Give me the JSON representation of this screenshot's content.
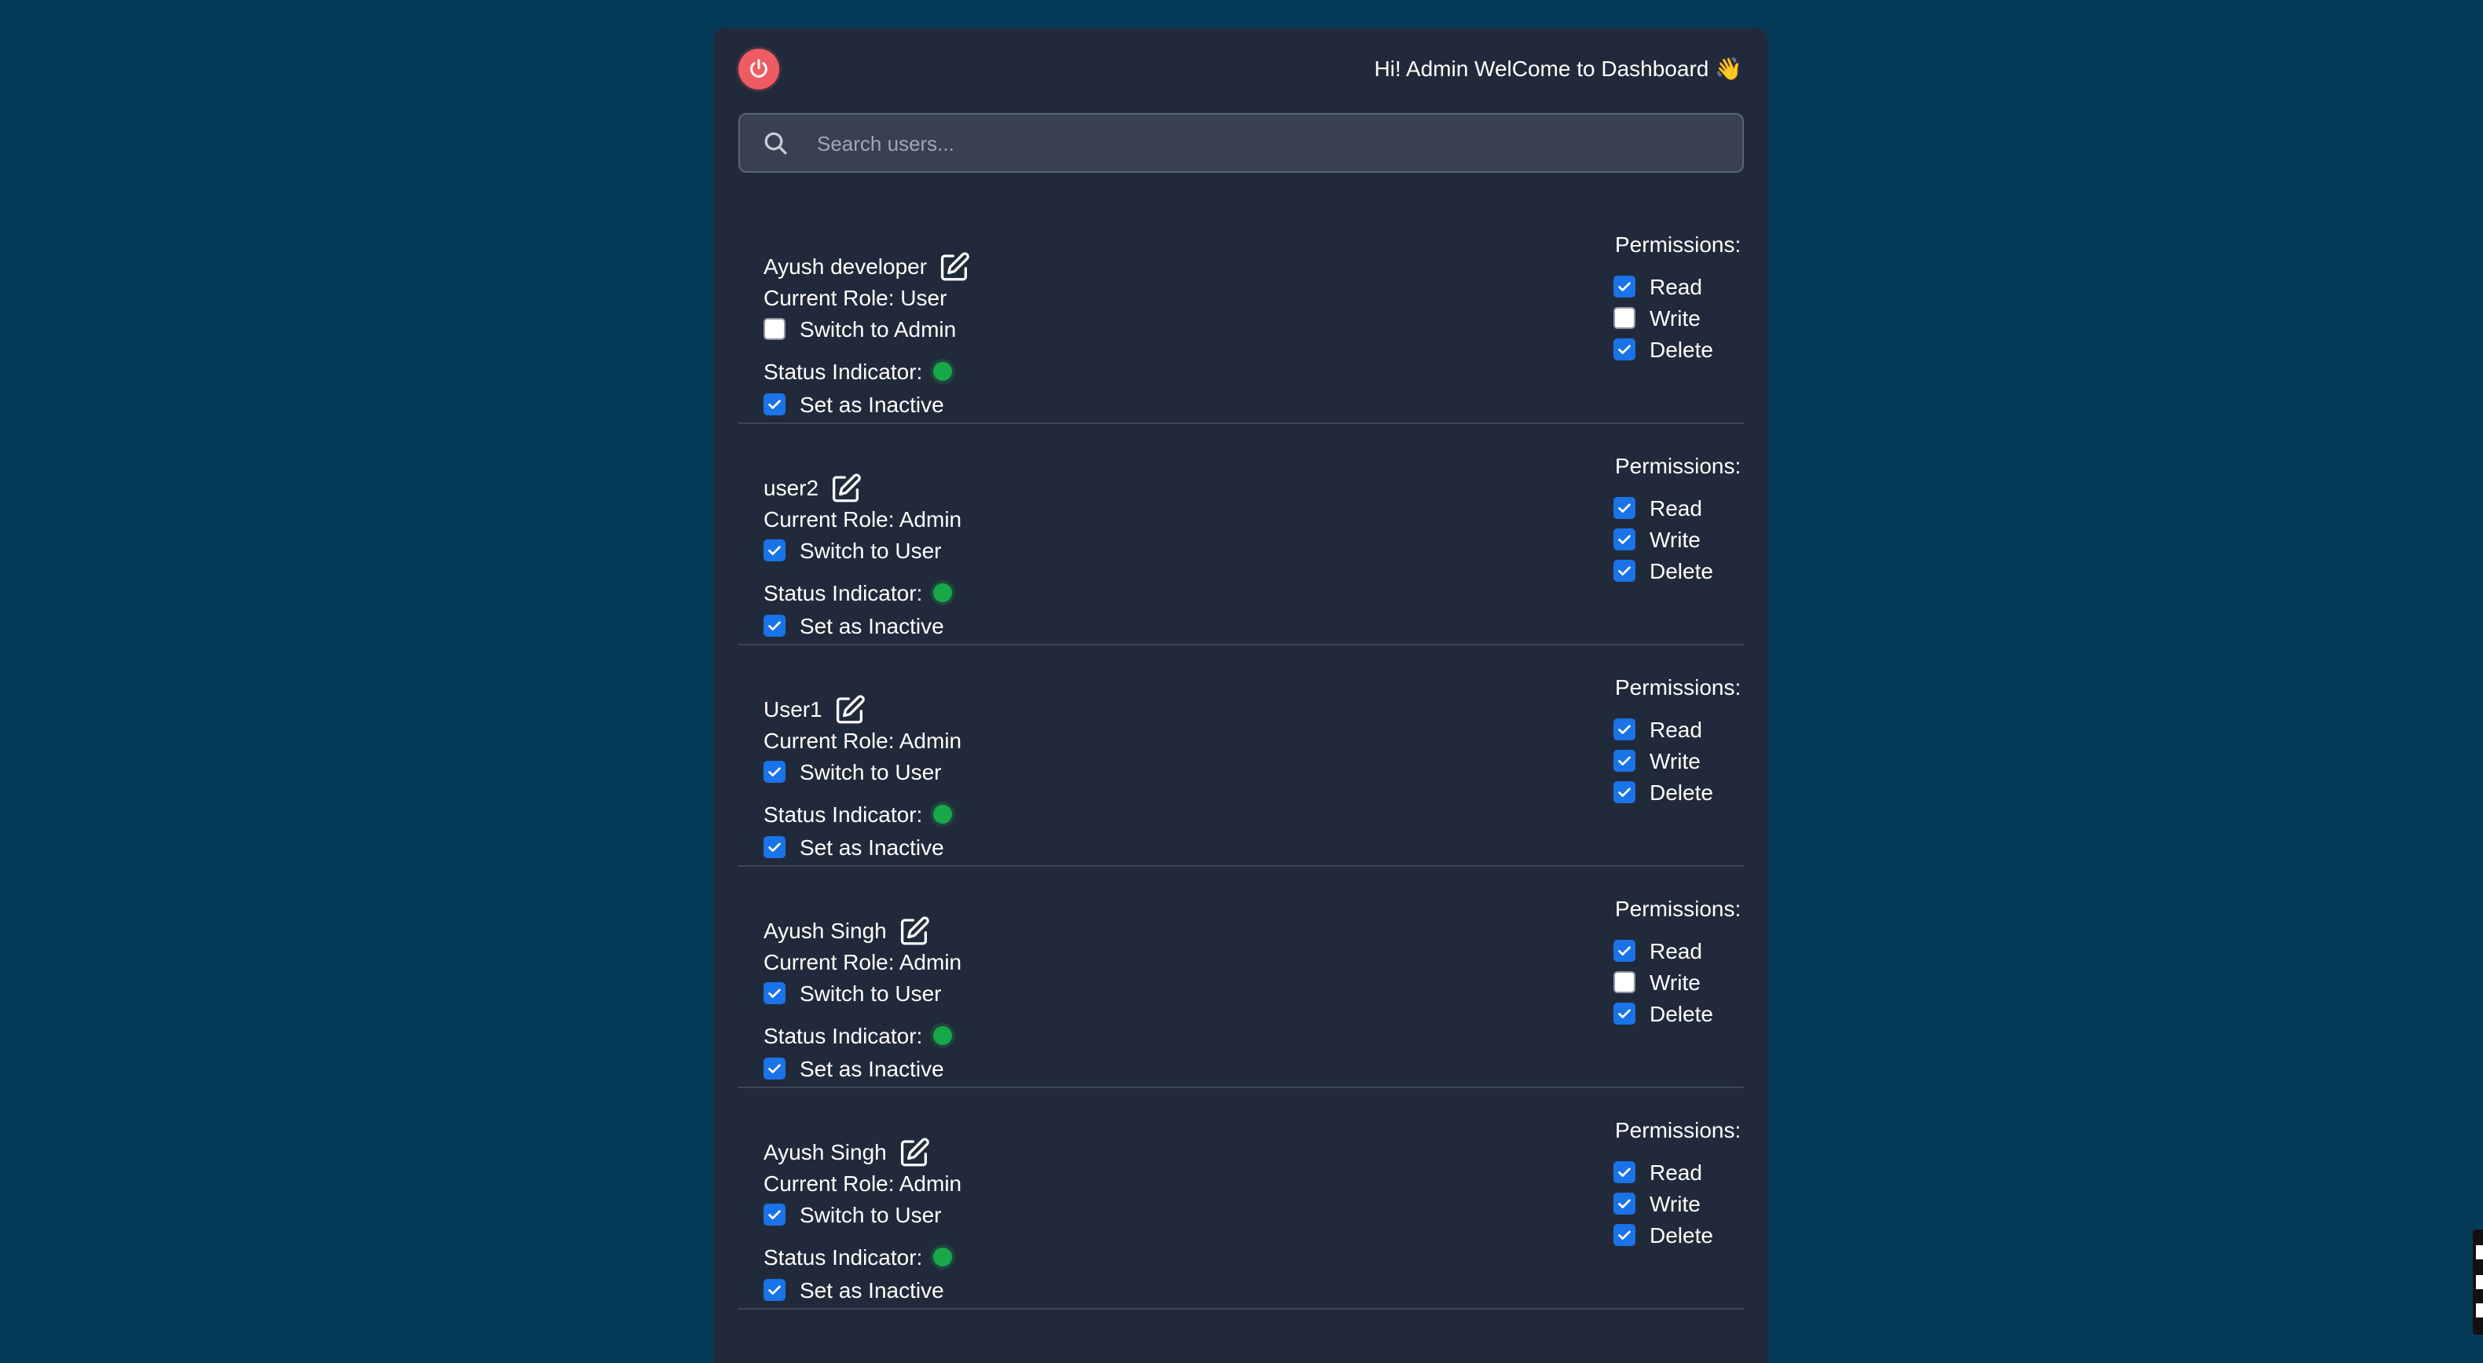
{
  "header": {
    "greeting": "Hi! Admin WelCome to Dashboard 👋"
  },
  "search": {
    "placeholder": "Search users...",
    "value": ""
  },
  "labels": {
    "permissions": "Permissions:",
    "status_indicator": "Status Indicator:",
    "read": "Read",
    "write": "Write",
    "delete": "Delete"
  },
  "users": [
    {
      "name": "Ayush developer",
      "role_text": "Current Role: User",
      "switch_label": "Switch to Admin",
      "switch_checked": false,
      "inactive_label": "Set as Inactive",
      "inactive_checked": true,
      "status_color": "#18a84a",
      "permissions": {
        "read": true,
        "write": false,
        "delete": true
      }
    },
    {
      "name": "user2",
      "role_text": "Current Role: Admin",
      "switch_label": "Switch to User",
      "switch_checked": true,
      "inactive_label": "Set as Inactive",
      "inactive_checked": true,
      "status_color": "#18a84a",
      "permissions": {
        "read": true,
        "write": true,
        "delete": true
      }
    },
    {
      "name": "User1",
      "role_text": "Current Role: Admin",
      "switch_label": "Switch to User",
      "switch_checked": true,
      "inactive_label": "Set as Inactive",
      "inactive_checked": true,
      "status_color": "#18a84a",
      "permissions": {
        "read": true,
        "write": true,
        "delete": true
      }
    },
    {
      "name": "Ayush Singh",
      "role_text": "Current Role: Admin",
      "switch_label": "Switch to User",
      "switch_checked": true,
      "inactive_label": "Set as Inactive",
      "inactive_checked": true,
      "status_color": "#18a84a",
      "permissions": {
        "read": true,
        "write": false,
        "delete": true
      }
    },
    {
      "name": "Ayush Singh",
      "role_text": "Current Role: Admin",
      "switch_label": "Switch to User",
      "switch_checked": true,
      "inactive_label": "Set as Inactive",
      "inactive_checked": true,
      "status_color": "#18a84a",
      "permissions": {
        "read": true,
        "write": true,
        "delete": true
      }
    }
  ],
  "theme": {
    "background": "#053b59",
    "panel": "#212a3a",
    "accent": "#1a73e8",
    "danger": "#ef5b63",
    "status_active": "#18a84a"
  },
  "icons": {
    "logout": "power-icon",
    "search": "search-icon",
    "edit": "edit-icon",
    "checkbox": "checkbox-icon",
    "status": "status-dot-icon"
  }
}
